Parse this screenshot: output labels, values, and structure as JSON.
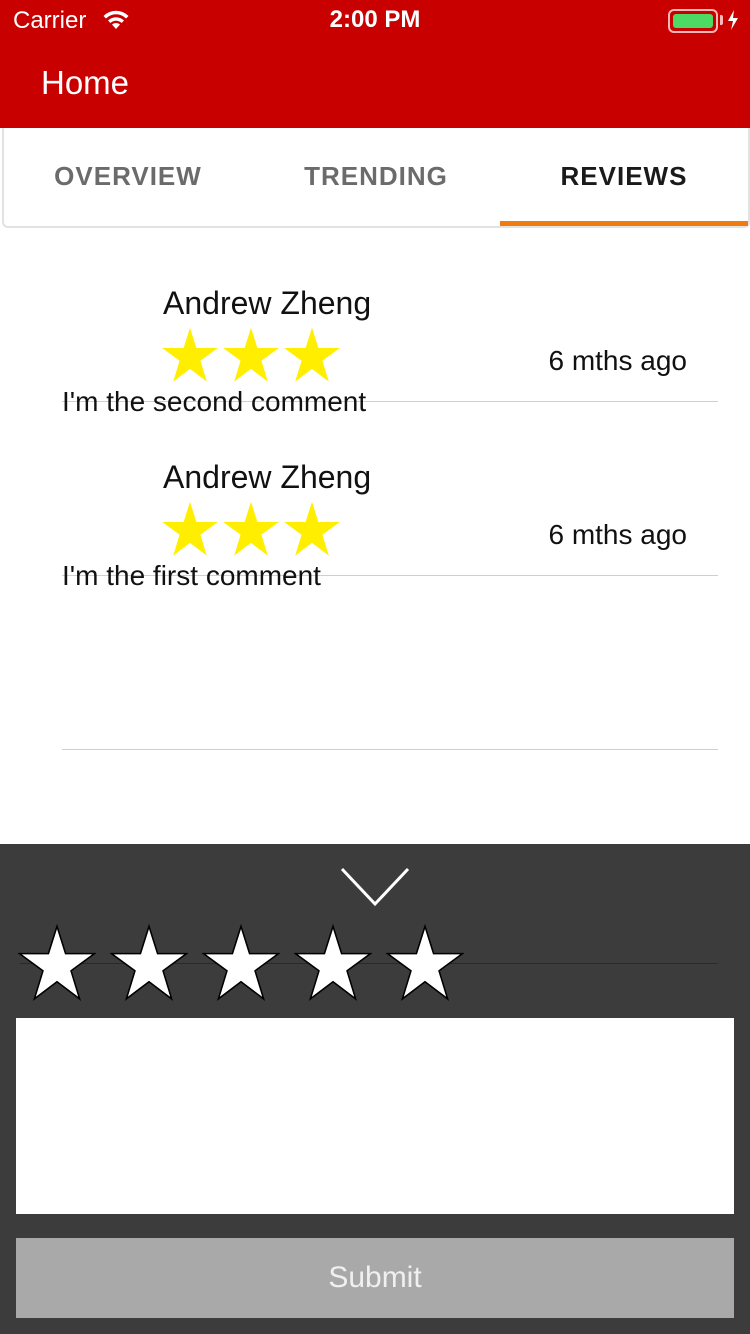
{
  "status_bar": {
    "carrier": "Carrier",
    "time": "2:00 PM",
    "battery_color": "#4cd964"
  },
  "nav": {
    "title": "Home",
    "background": "#c90000"
  },
  "tabs": [
    {
      "label": "OVERVIEW",
      "active": false
    },
    {
      "label": "TRENDING",
      "active": false
    },
    {
      "label": "REVIEWS",
      "active": true
    }
  ],
  "tab_indicator_color": "#f07c10",
  "reviews": [
    {
      "author": "Andrew Zheng",
      "rating": 3,
      "time": "6 mths ago",
      "comment": "I'm the second comment"
    },
    {
      "author": "Andrew Zheng",
      "rating": 3,
      "time": "6 mths ago",
      "comment": "I'm the first comment"
    }
  ],
  "review_star_color": "#ffee00",
  "composer": {
    "collapse_icon": "chevron-down-icon",
    "rating": 0,
    "max_rating": 5,
    "comment_value": "",
    "submit_label": "Submit"
  }
}
